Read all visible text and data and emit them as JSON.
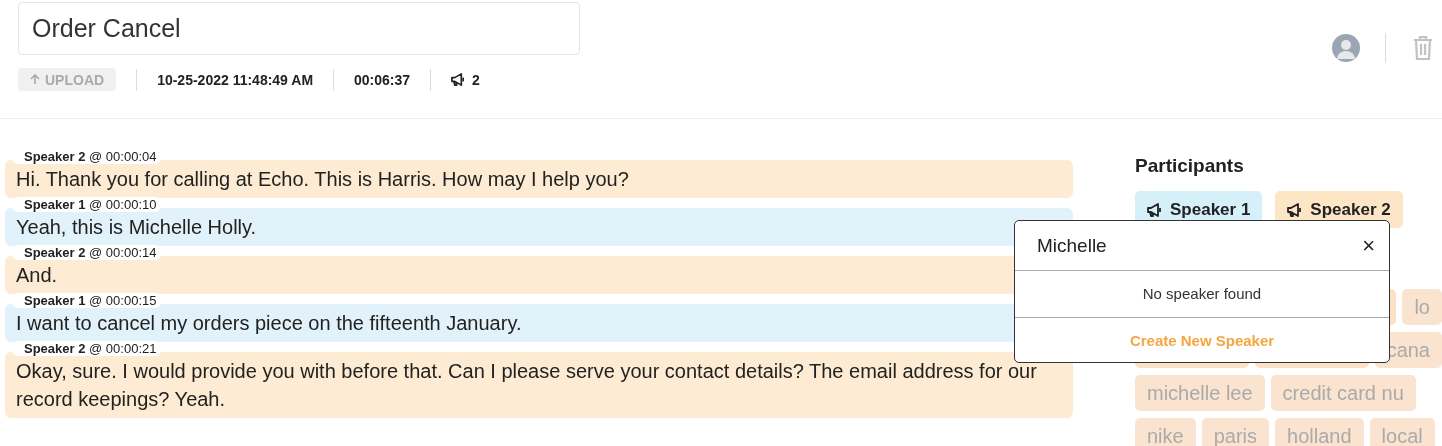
{
  "title_field": {
    "value": "Order Cancel"
  },
  "meta": {
    "upload": "UPLOAD",
    "date": "10-25-2022 11:48:49 AM",
    "duration": "00:06:37",
    "speakers": "2"
  },
  "transcript": [
    {
      "speaker": "Speaker 2",
      "time": "@ 00:00:04",
      "color": "#fdebd3",
      "text": "Hi. Thank you for calling at Echo. This is Harris. How may I help you?"
    },
    {
      "speaker": "Speaker 1",
      "time": "@ 00:00:10",
      "color": "#e2f2fa",
      "text": "Yeah, this is Michelle Holly."
    },
    {
      "speaker": "Speaker 2",
      "time": "@ 00:00:14",
      "color": "#fdebd3",
      "text": "And."
    },
    {
      "speaker": "Speaker 1",
      "time": "@ 00:00:15",
      "color": "#e2f2fa",
      "text": "I want to cancel my orders piece on the fifteenth January."
    },
    {
      "speaker": "Speaker 2",
      "time": "@ 00:00:21",
      "color": "#fdebd3",
      "text": "Okay, sure. I would provide you with before that. Can I please serve your contact details? The email address for our record keepings? Yeah."
    }
  ],
  "participants": {
    "title": "Participants",
    "items": [
      {
        "label": "Speaker 1",
        "color": "#d6f0fa"
      },
      {
        "label": "Speaker 2",
        "color": "#fde6c6"
      }
    ]
  },
  "keyword_rows": [
    [
      {
        "covered": true
      },
      {
        "covered": false,
        "label": "lo"
      }
    ],
    [
      {
        "covered": true
      },
      {
        "covered": true
      },
      {
        "covered": false,
        "label": "cana"
      }
    ],
    [
      {
        "covered": false,
        "label": "michelle lee"
      },
      {
        "covered": false,
        "label": "credit card nu"
      }
    ],
    [
      {
        "covered": false,
        "label": "nike"
      },
      {
        "covered": false,
        "label": "paris"
      },
      {
        "covered": false,
        "label": "holland"
      },
      {
        "covered": false,
        "label": "local"
      }
    ]
  ],
  "speaker_popup": {
    "value": "Michelle",
    "close": "×",
    "empty": "No speaker found",
    "create": "Create New Speaker"
  }
}
